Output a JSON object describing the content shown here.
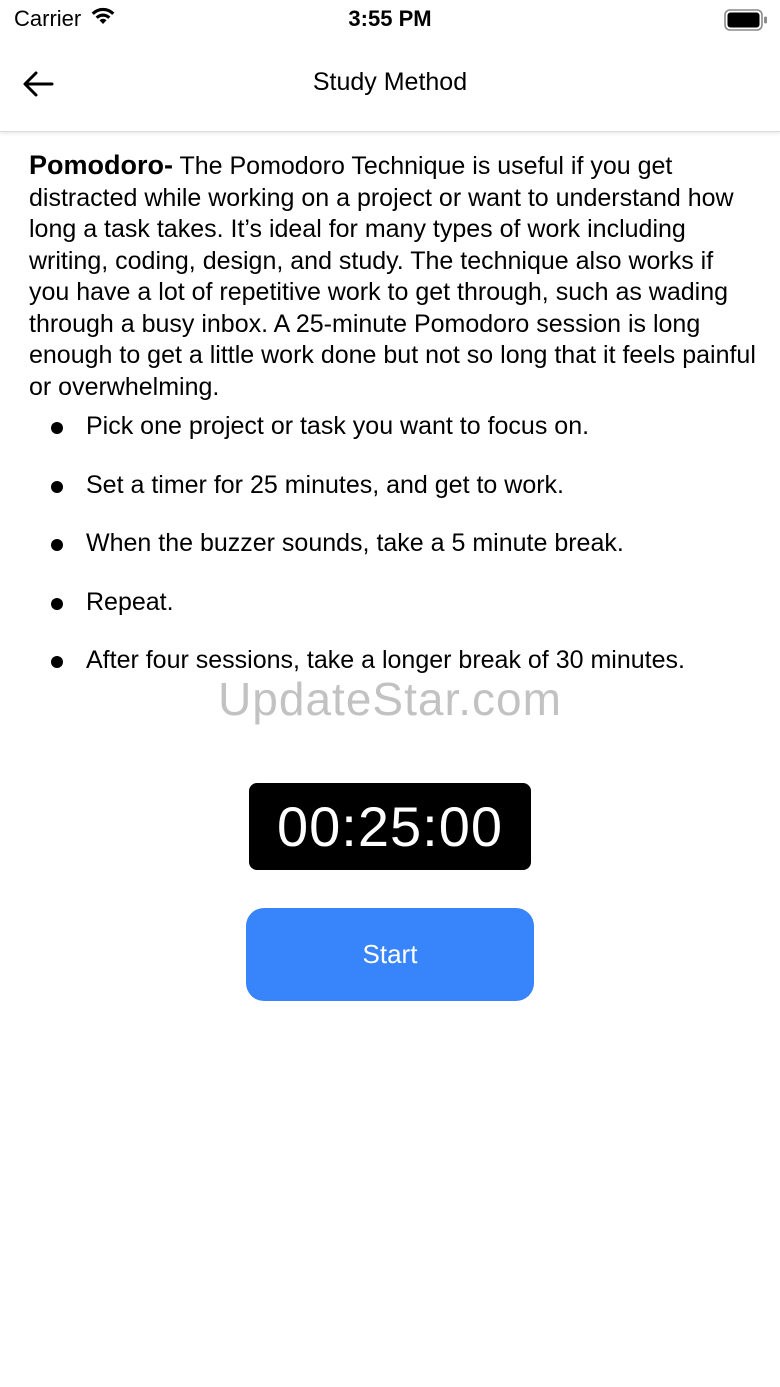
{
  "status_bar": {
    "carrier": "Carrier",
    "time": "3:55 PM",
    "icons": [
      "wifi-icon",
      "battery-icon"
    ]
  },
  "nav": {
    "title": "Study Method",
    "back_icon": "arrow-left-icon"
  },
  "content": {
    "heading": "Pomodoro-",
    "description": " The Pomodoro Technique is useful if you get distracted while working on a project or want to understand how long a task takes. It’s ideal for many types of work including writing, coding, design, and study. The technique also works if you have a lot of repetitive work to get through, such as wading through a busy inbox. A 25-minute Pomodoro session is long enough to get a little work done but not so long that it feels painful or overwhelming.",
    "steps": [
      "Pick one project or task you want to focus on.",
      "Set a timer for 25 minutes, and get to work.",
      "When the buzzer sounds, take a 5 minute break.",
      "Repeat.",
      "After four sessions, take a longer break of 30 minutes."
    ]
  },
  "timer": {
    "display": "00:25:00"
  },
  "actions": {
    "start_label": "Start"
  },
  "watermark": "UpdateStar.com",
  "colors": {
    "accent": "#3784fb",
    "timer_bg": "#000000",
    "text": "#000000",
    "background": "#ffffff"
  }
}
